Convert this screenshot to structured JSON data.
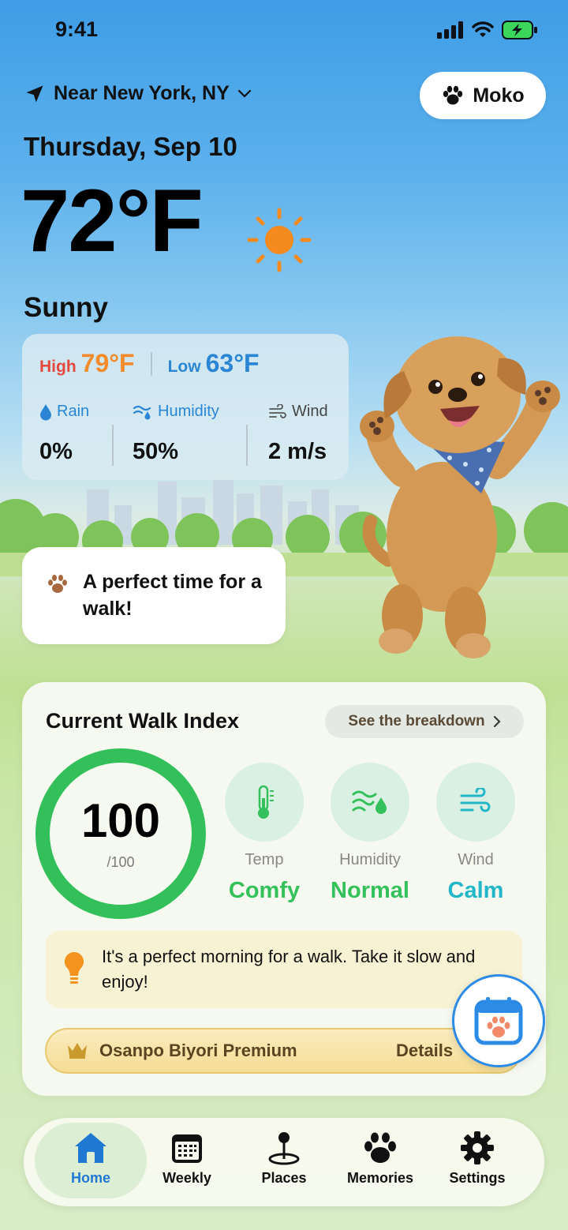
{
  "status_bar": {
    "time": "9:41"
  },
  "header": {
    "location": "Near New York, NY",
    "pet_name": "Moko",
    "date": "Thursday, Sep 10",
    "temperature": "72°F",
    "condition": "Sunny"
  },
  "weather": {
    "high_label": "High",
    "high_value": "79°F",
    "low_label": "Low",
    "low_value": "63°F",
    "rain_label": "Rain",
    "rain_value": "0%",
    "humidity_label": "Humidity",
    "humidity_value": "50%",
    "wind_label": "Wind",
    "wind_value": "2 m/s"
  },
  "bubble": {
    "text": "A perfect time for a walk!"
  },
  "walk_index": {
    "title": "Current Walk Index",
    "breakdown_label": "See the breakdown",
    "score": "100",
    "score_max": "/100",
    "metrics": [
      {
        "label": "Temp",
        "value": "Comfy",
        "color": "#34c05a"
      },
      {
        "label": "Humidity",
        "value": "Normal",
        "color": "#34c05a"
      },
      {
        "label": "Wind",
        "value": "Calm",
        "color": "#22b6c9"
      }
    ],
    "tip": "It's a perfect morning for a walk. Take it slow and enjoy!",
    "premium_label": "Osanpo Biyori Premium",
    "premium_details": "Details"
  },
  "tabs": [
    {
      "label": "Home",
      "icon": "house-icon",
      "active": true
    },
    {
      "label": "Weekly",
      "icon": "calendar-grid-icon",
      "active": false
    },
    {
      "label": "Places",
      "icon": "map-pin-icon",
      "active": false
    },
    {
      "label": "Memories",
      "icon": "paw-icon",
      "active": false
    },
    {
      "label": "Settings",
      "icon": "gear-icon",
      "active": false
    }
  ],
  "colors": {
    "accent": "#1f78d1",
    "good": "#34c05a",
    "high": "#f28b2b",
    "low": "#2a86d4"
  }
}
